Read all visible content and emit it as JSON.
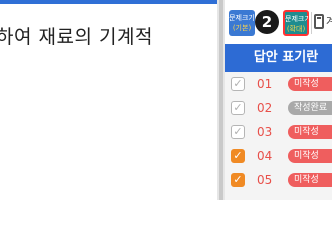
{
  "question": {
    "text": "하여 재료의 기계적"
  },
  "toolbar": {
    "font_small": {
      "line1": "문제크기",
      "line2": "(기본)"
    },
    "font_large": {
      "line1": "문제크기",
      "line2": "(확대)"
    },
    "step_badge": "2",
    "calculator_icon": "calculator-icon",
    "calculator_label": "계"
  },
  "answer_panel": {
    "title": "답안 표기란",
    "rows": [
      {
        "number": "01",
        "checked": false,
        "status": "미작성",
        "status_color": "#ef5e5e"
      },
      {
        "number": "02",
        "checked": false,
        "status": "작성완료",
        "status_color": "#a9a9a9"
      },
      {
        "number": "03",
        "checked": false,
        "status": "미작성",
        "status_color": "#ef5e5e"
      },
      {
        "number": "04",
        "checked": true,
        "status": "미작성",
        "status_color": "#ef5e5e"
      },
      {
        "number": "05",
        "checked": true,
        "status": "미작성",
        "status_color": "#ef5e5e"
      }
    ]
  },
  "colors": {
    "accent": "#2d6bd4",
    "checked": "#f08a24",
    "unanswered": "#ef5e5e",
    "answered": "#a9a9a9",
    "highlight_border": "#ff3333"
  }
}
